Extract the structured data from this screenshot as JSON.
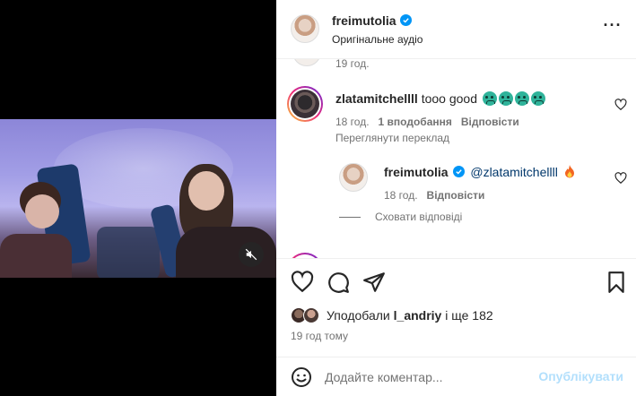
{
  "post": {
    "author": "freimutolia",
    "audio": "Оригінальне аудіо",
    "author_verified": true
  },
  "comments": {
    "previous_time": "19 год.",
    "items": [
      {
        "username": "zlatamitchellll",
        "text": "tooo good",
        "emojis": [
          "crying-face",
          "crying-face",
          "crying-face",
          "crying-face"
        ],
        "time": "18 год.",
        "likes": "1 вподобання",
        "reply_label": "Відповісти",
        "translate_label": "Переглянути переклад",
        "replies": [
          {
            "username": "freimutolia",
            "verified": true,
            "mention": "@zlatamitchellll",
            "emojis": [
              "fire"
            ],
            "time": "18 год.",
            "reply_label": "Відповісти"
          }
        ],
        "hide_replies_label": "Сховати відповіді"
      }
    ]
  },
  "footer": {
    "likes_prefix": "Уподобали",
    "likes_user": "l_andriy",
    "likes_suffix": "і ще 182",
    "time_ago": "19 год тому",
    "comment_placeholder": "Додайте коментар...",
    "post_label": "Опублікувати"
  },
  "icons": {
    "like": "heart-icon",
    "comment": "comment-icon",
    "share": "share-icon",
    "save": "bookmark-icon",
    "more": "more-icon",
    "mute": "muted-speaker-icon",
    "emoji": "emoji-icon"
  },
  "colors": {
    "verified": "#0095f6",
    "link": "#00376b",
    "post_button_disabled": "#b2dffc",
    "secondary_text": "#737373"
  }
}
